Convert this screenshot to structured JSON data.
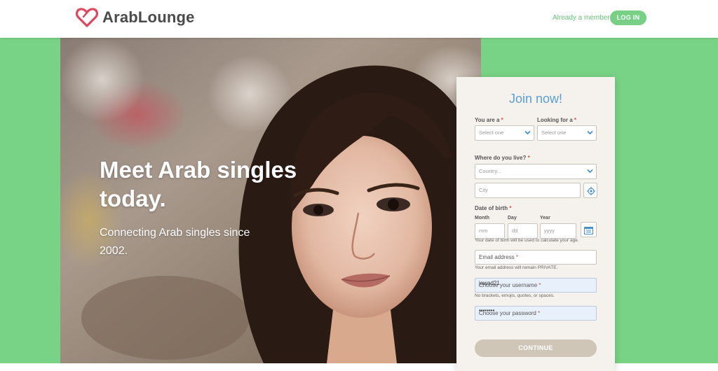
{
  "header": {
    "logo_text": "ArabLounge",
    "already_member": "Already a member?",
    "login_label": "LOG IN"
  },
  "hero": {
    "title": "Meet Arab singles today.",
    "subtitle": "Connecting Arab singles since 2002."
  },
  "form": {
    "title": "Join now!",
    "you_are_label": "You are a",
    "you_are_value": "Select one",
    "looking_for_label": "Looking for a",
    "looking_for_value": "Select one",
    "where_live_label": "Where do you live?",
    "country_placeholder": "Country...",
    "city_placeholder": "City",
    "dob_label": "Date of birth",
    "month_label": "Month",
    "day_label": "Day",
    "year_label": "Year",
    "month_placeholder": "mm",
    "day_placeholder": "dd",
    "year_placeholder": "yyyy",
    "dob_hint": "Your date of birth will be used to calculate your age.",
    "email_label": "Email address",
    "email_hint": "Your email address will remain PRIVATE.",
    "username_label": "Choose your username",
    "username_value": "jawad21",
    "username_hint": "No brackets, emojis, quotes, or spaces.",
    "password_label": "Choose your password",
    "password_value": "••••••••",
    "continue_label": "CONTINUE"
  },
  "colors": {
    "brand_green": "#79d386",
    "logo_red": "#e0475e",
    "title_blue": "#5a9fd4",
    "required_red": "#e04a4a"
  }
}
